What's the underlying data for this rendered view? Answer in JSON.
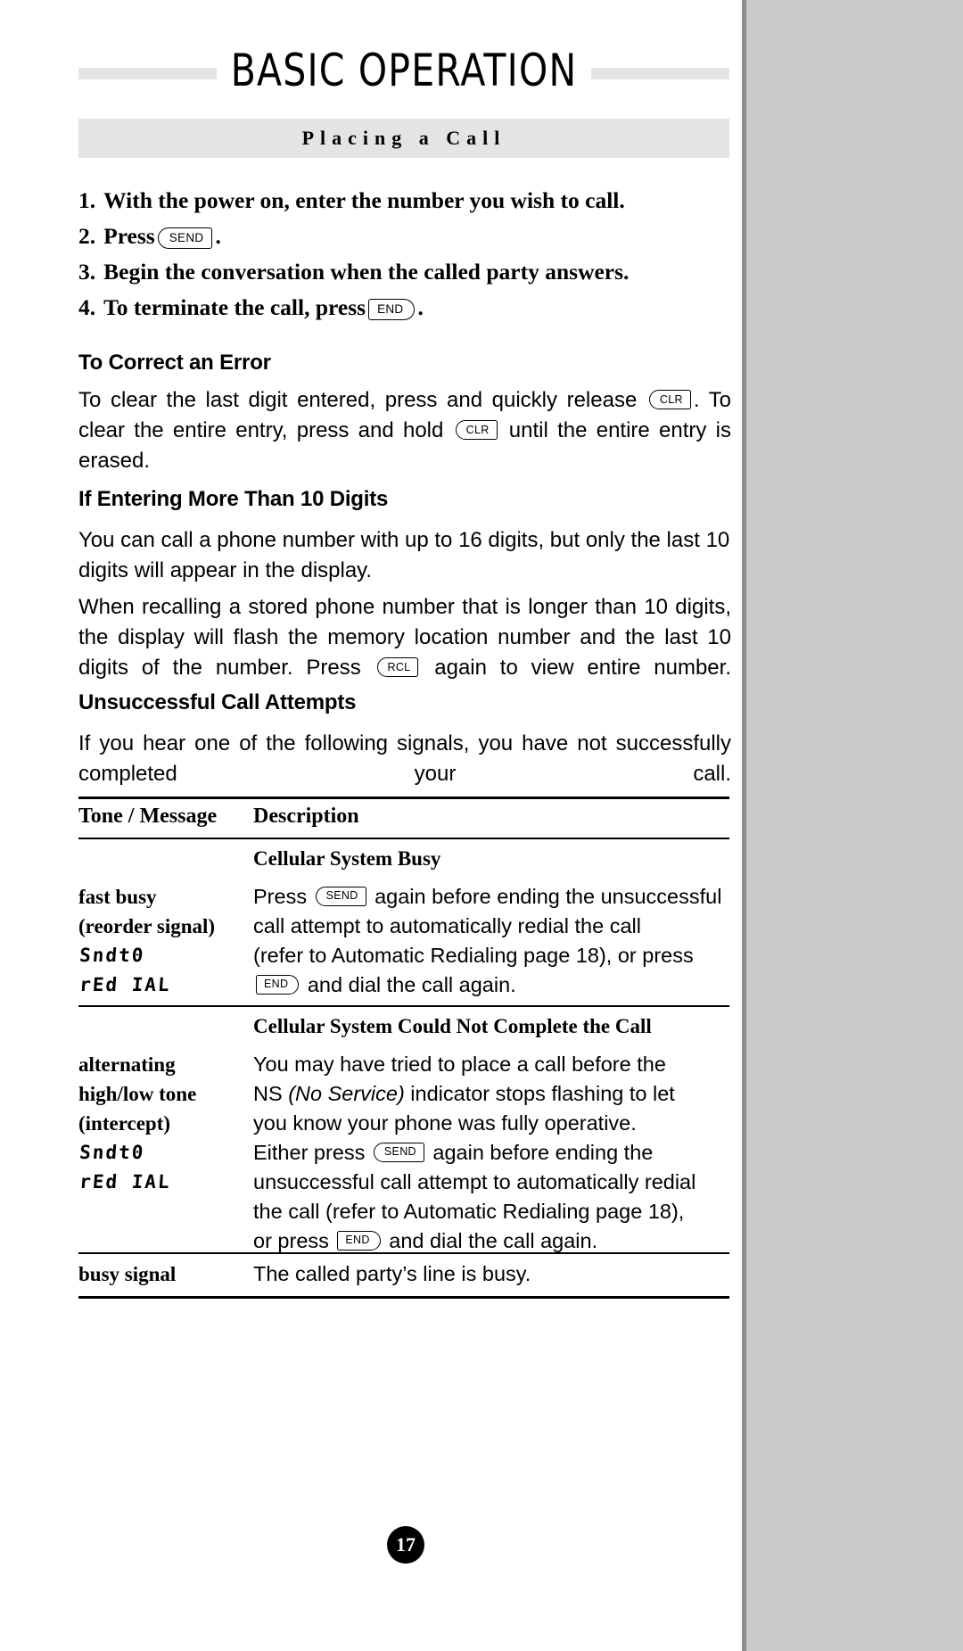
{
  "page": {
    "chapter_title": "BASIC OPERATION",
    "section_title": "Placing a Call",
    "folio": "17"
  },
  "steps": [
    {
      "num": "1.",
      "text_before": "With the power on, enter the number you wish to call.",
      "key": null,
      "text_after": ""
    },
    {
      "num": "2.",
      "text_before": "Press",
      "key": "SEND",
      "text_after": "."
    },
    {
      "num": "3.",
      "text_before": "Begin the conversation when the called party answers.",
      "key": null,
      "text_after": ""
    },
    {
      "num": "4.",
      "text_before": "To terminate the call, press",
      "key": "END",
      "text_after": "."
    }
  ],
  "sections": [
    {
      "heading": "To Correct an Error",
      "body_a": "To clear the last digit entered, press and quickly release",
      "key_a": "CLR",
      "body_b": ". To clear the entire entry, press and hold",
      "key_b": "CLR",
      "body_c": "until the entire entry is erased."
    },
    {
      "heading": "If Entering More Than 10 Digits",
      "paragraph_1": "You can call a phone number with up to 16 digits, but only the last 10 digits will appear in the display.",
      "paragraph_2_a": "When recalling a stored phone number that is longer than 10 digits, the display will flash the memory location number and the last 10 digits of the number. Press",
      "key_a": "RCL",
      "paragraph_2_b": "again to view entire number."
    },
    {
      "heading": "Unsuccessful Call Attempts",
      "paragraph_1": "If you hear one of the following signals, you have not successfully completed your call."
    }
  ],
  "table": {
    "headers": [
      "Tone / Message",
      "Description"
    ],
    "rows": [
      {
        "type": "banner",
        "banner": "Cellular System Busy"
      },
      {
        "type": "entry",
        "tone_lines": [
          "fast busy",
          "(reorder signal)"
        ],
        "lcd_lines": [
          "Sndt0",
          "rEd IAL"
        ],
        "desc_lines": [
          {
            "text_before": "Press",
            "key": "SEND",
            "text_after": "again before ending the unsuccessful"
          },
          {
            "text_before": "call attempt to automatically redial the call",
            "key": null,
            "text_after": ""
          },
          {
            "text_before": "(refer to Automatic Redialing page 18), or press",
            "key": null,
            "text_after": ""
          },
          {
            "text_before": "",
            "key": "END",
            "text_after": "and dial the call again."
          }
        ]
      },
      {
        "type": "banner",
        "banner": "Cellular System Could Not Complete the Call"
      },
      {
        "type": "entry",
        "tone_lines": [
          "alternating",
          "high/low tone",
          "(intercept)"
        ],
        "lcd_lines": [
          "Sndt0",
          "rEd IAL"
        ],
        "desc_lines": [
          {
            "text_before": "You may have tried to place a call before the",
            "key": null,
            "text_after": ""
          },
          {
            "text_before": "NS ",
            "italic": "(No Service)",
            "key": null,
            "text_after": " indicator stops flashing to let"
          },
          {
            "text_before": "you know your phone was fully operative.",
            "key": null,
            "text_after": ""
          },
          {
            "text_before": "Either press",
            "key": "SEND",
            "text_after": "again before ending the"
          },
          {
            "text_before": "unsuccessful call attempt to automatically redial",
            "key": null,
            "text_after": ""
          },
          {
            "text_before": "the call (refer to Automatic Redialing page 18),",
            "key": null,
            "text_after": ""
          },
          {
            "text_before": "or press",
            "key": "END",
            "text_after": "and dial the call again."
          }
        ]
      },
      {
        "type": "entry",
        "tone_lines": [
          "busy signal"
        ],
        "lcd_lines": [],
        "desc_lines": [
          {
            "text_before": "The called party’s line is busy.",
            "key": null,
            "text_after": ""
          }
        ]
      }
    ]
  }
}
